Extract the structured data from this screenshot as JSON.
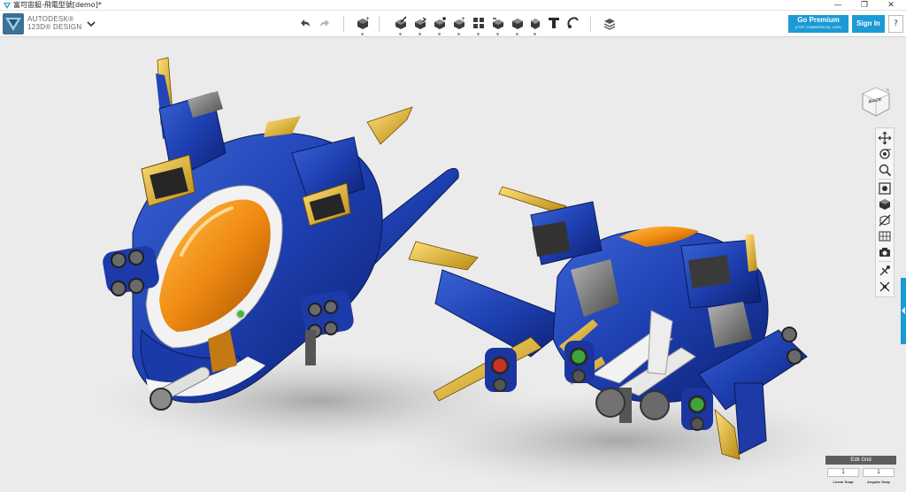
{
  "window": {
    "title": "富可宙艇-飛電型號[demo]*",
    "minimize": "—",
    "restore": "❐",
    "close": "✕"
  },
  "app": {
    "brand_line1": "AUTODESK®",
    "brand_line2": "123D® DESIGN",
    "accent_color": "#1c9ad6"
  },
  "toolbar": {
    "icons": [
      "undo-icon",
      "redo-icon",
      "primitives-icon",
      "sketch-icon",
      "construct-icon",
      "modify-icon",
      "pattern-icon",
      "grouping-icon",
      "combine-icon",
      "measure-icon",
      "text-icon",
      "snap-icon",
      "material-icon"
    ]
  },
  "account": {
    "premium_label": "Go Premium",
    "premium_sub": "(FOR COMMERCIAL USE)",
    "signin_label": "Sign In",
    "help_label": "?"
  },
  "viewcube": {
    "face_label": "BACK"
  },
  "navbar": {
    "icons": [
      "pan-icon",
      "orbit-icon",
      "zoom-icon",
      "fit-icon",
      "view-mode-icon",
      "hide-icon",
      "material-view-icon",
      "screenshot-icon",
      "visibility-icon",
      "snap-icon"
    ]
  },
  "grid": {
    "title": "Edit Grid",
    "linear_value": "1",
    "angular_value": "1",
    "linear_label": "Linear Snap",
    "angular_label": "Angular Snap"
  }
}
